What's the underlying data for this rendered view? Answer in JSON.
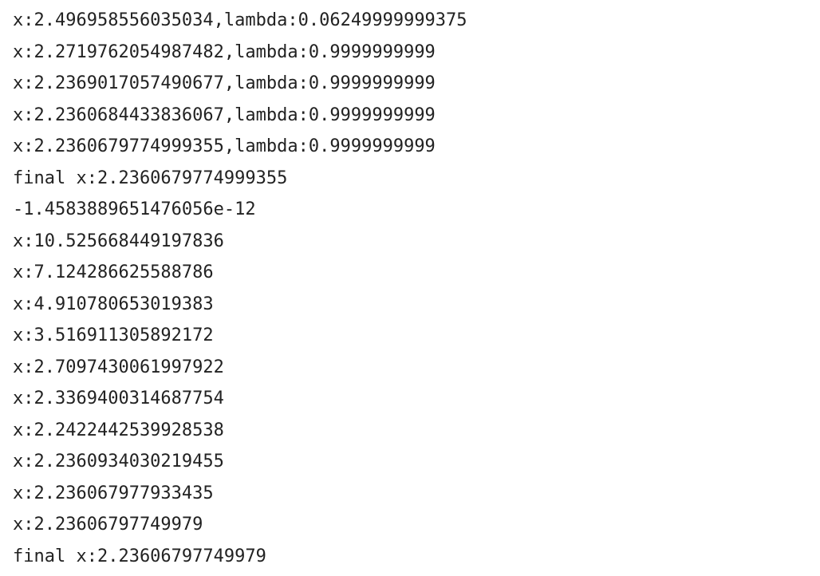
{
  "console": {
    "lines": [
      "x:2.496958556035034,lambda:0.06249999999375",
      "x:2.2719762054987482,lambda:0.9999999999",
      "x:2.2369017057490677,lambda:0.9999999999",
      "x:2.2360684433836067,lambda:0.9999999999",
      "x:2.2360679774999355,lambda:0.9999999999",
      "final x:2.2360679774999355",
      "-1.4583889651476056e-12",
      "x:10.525668449197836",
      "x:7.124286625588786",
      "x:4.910780653019383",
      "x:3.516911305892172",
      "x:2.7097430061997922",
      "x:2.3369400314687754",
      "x:2.2422442539928538",
      "x:2.2360934030219455",
      "x:2.236067977933435",
      "x:2.23606797749979",
      "final x:2.23606797749979"
    ]
  }
}
